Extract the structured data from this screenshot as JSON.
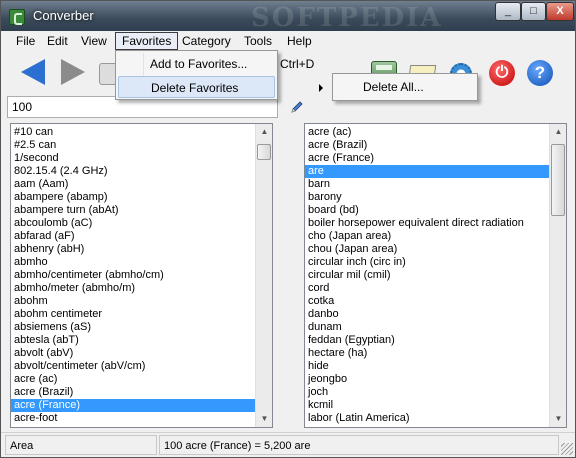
{
  "window": {
    "title": "Converber",
    "watermark": "SOFTPEDIA",
    "minimize_glyph": "_",
    "maximize_glyph": "□",
    "close_glyph": "X"
  },
  "menubar": {
    "items": [
      "File",
      "Edit",
      "View",
      "Favorites",
      "Category",
      "Tools",
      "Help"
    ],
    "active": "Favorites"
  },
  "toolbar": {
    "icons": [
      "back-arrow-icon",
      "forward-arrow-icon",
      "blank-icon",
      "calculator-icon",
      "mail-icon",
      "gear-icon",
      "power-icon",
      "help-icon"
    ],
    "power_glyph": "⏻",
    "help_glyph": "?"
  },
  "input": {
    "value": "100"
  },
  "favorites_menu": {
    "items": [
      {
        "label": "Add to Favorites...",
        "shortcut": "Ctrl+D"
      },
      {
        "label": "Delete Favorites",
        "shortcut": ""
      }
    ],
    "submenu": {
      "items": [
        "Delete All..."
      ]
    }
  },
  "left_list": {
    "items": [
      "#10 can",
      "#2.5 can",
      "1/second",
      "802.15.4 (2.4 GHz)",
      "aam (Aam)",
      "abampere (abamp)",
      "abampere turn (abAt)",
      "abcoulomb (aC)",
      "abfarad (aF)",
      "abhenry (abH)",
      "abmho",
      "abmho/centimeter (abmho/cm)",
      "abmho/meter (abmho/m)",
      "abohm",
      "abohm centimeter",
      "absiemens (aS)",
      "abtesla (abT)",
      "abvolt (abV)",
      "abvolt/centimeter (abV/cm)",
      "acre (ac)",
      "acre (Brazil)",
      "acre (France)",
      "acre-foot"
    ],
    "selected_index": 21
  },
  "right_list": {
    "items": [
      "acre (ac)",
      "acre (Brazil)",
      "acre (France)",
      "are",
      "barn",
      "barony",
      "board (bd)",
      "boiler horsepower equivalent direct radiation",
      "cho (Japan area)",
      "chou (Japan area)",
      "circular inch (circ in)",
      "circular mil (cmil)",
      "cord",
      "cotka",
      "danbo",
      "dunam",
      "feddan (Egyptian)",
      "hectare (ha)",
      "hide",
      "jeongbo",
      "joch",
      "kcmil",
      "labor (Latin America)"
    ],
    "selected_index": 3
  },
  "statusbar": {
    "category": "Area",
    "result": "100 acre (France) = 5,200 are"
  }
}
